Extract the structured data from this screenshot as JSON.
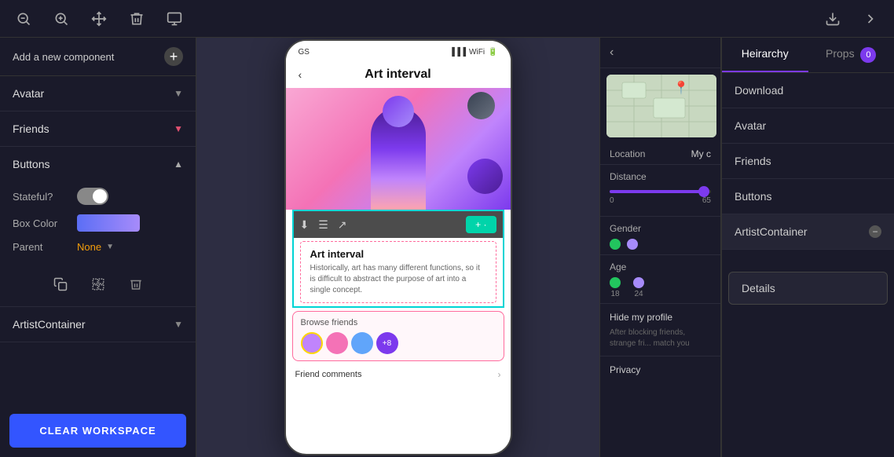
{
  "toolbar": {
    "zoom_out_label": "zoom-out",
    "zoom_in_label": "zoom-in",
    "move_label": "move",
    "delete_label": "delete",
    "add_component_label": "add-component",
    "download_label": "download",
    "forward_label": "forward"
  },
  "left_panel": {
    "add_component_text": "Add a new component",
    "add_btn_label": "+",
    "components": [
      {
        "name": "Avatar",
        "expanded": false,
        "chevron": "down"
      },
      {
        "name": "Friends",
        "expanded": false,
        "chevron": "down-pink"
      },
      {
        "name": "Buttons",
        "expanded": true,
        "chevron": "up"
      },
      {
        "name": "ArtistContainer",
        "expanded": false,
        "chevron": "down"
      }
    ],
    "buttons_props": {
      "stateful_label": "Stateful?",
      "box_color_label": "Box Color",
      "parent_label": "Parent",
      "parent_value": "None"
    },
    "icon_actions": {
      "duplicate_label": "duplicate",
      "selection_label": "selection",
      "delete_label": "delete"
    },
    "clear_workspace_label": "CLEAR WORKSPACE"
  },
  "canvas": {
    "app_title": "Art interval",
    "card_title": "Art interval",
    "card_desc": "Historically, art has many different functions, so it is difficult to abstract the purpose of art into a single concept.",
    "friends_label": "Browse friends",
    "friends_more": "+8",
    "comments_label": "Friend comments",
    "share_label": "+ ·"
  },
  "right_panel": {
    "tabs": [
      {
        "label": "Heirarchy",
        "active": true
      },
      {
        "label": "Props",
        "active": false
      }
    ],
    "avatar_label": "0",
    "hierarchy_items": [
      {
        "name": "Download",
        "has_minus": false
      },
      {
        "name": "Avatar",
        "has_minus": false
      },
      {
        "name": "Friends",
        "has_minus": false
      },
      {
        "name": "Buttons",
        "has_minus": false
      },
      {
        "name": "ArtistContainer",
        "has_minus": true
      }
    ]
  },
  "extra_panel": {
    "location_label": "Location",
    "location_value": "My c",
    "distance_label": "Distance",
    "distance_min": "0",
    "distance_max": "65",
    "gender_label": "Gender",
    "age_label": "Age",
    "age_values": [
      {
        "value": "18",
        "color": "green"
      },
      {
        "value": "24",
        "color": "purple"
      }
    ],
    "hide_profile_label": "Hide my profile",
    "hide_profile_desc": "After blocking friends, strange fri... match you",
    "privacy_label": "Privacy"
  },
  "details_popup": {
    "label": "Details"
  }
}
